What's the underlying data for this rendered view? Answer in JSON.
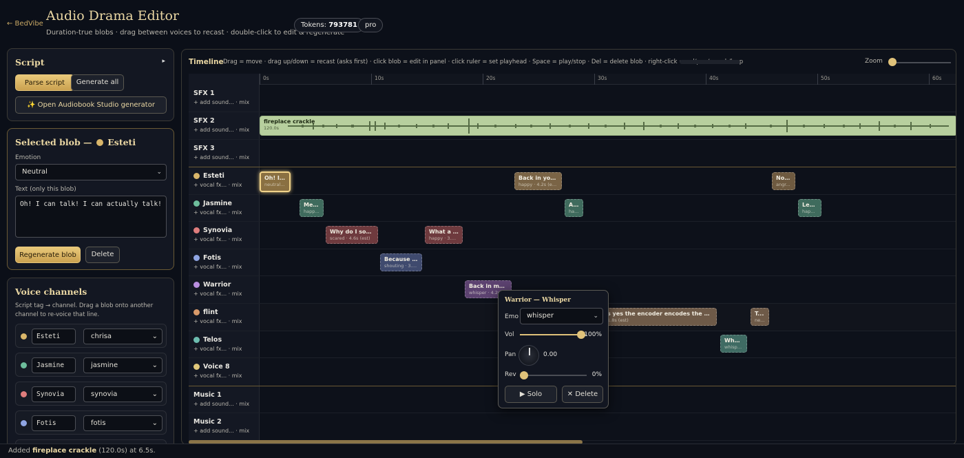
{
  "header": {
    "back_link": "← BedVibe",
    "title": "Audio Drama Editor",
    "subtitle": "Duration-true blobs · drag between voices to recast · double-click to edit & regenerate",
    "tokens_label": "Tokens:",
    "tokens_value": "793781",
    "plan": "pro"
  },
  "script_panel": {
    "title": "Script",
    "toggle": "▸",
    "parse_btn": "Parse script",
    "generate_btn": "Generate all",
    "audiobook_btn": "✨ Open Audiobook Studio generator"
  },
  "selected_panel": {
    "title": "Selected blob —",
    "voice": "Esteti",
    "emotion_label": "Emotion",
    "emotion_value": "Neutral",
    "text_label": "Text (only this blob)",
    "text_value": "Oh! I can talk! I can actually talk!",
    "regen_btn": "Regenerate blob",
    "delete_btn": "Delete"
  },
  "voice_panel": {
    "title": "Voice channels",
    "desc": "Script tag → channel. Drag a blob onto another channel to re-voice that line.",
    "rows": [
      {
        "name": "Esteti",
        "voice": "chrisa",
        "color": "#d9b66a"
      },
      {
        "name": "Jasmine",
        "voice": "jasmine",
        "color": "#6dbd9c"
      },
      {
        "name": "Synovia",
        "voice": "synovia",
        "color": "#df7d7d"
      },
      {
        "name": "Fotis",
        "voice": "fotis",
        "color": "#8fa5e3"
      }
    ]
  },
  "timeline": {
    "title": "Timeline",
    "help": "Drag = move · drag up/down = recast (asks first) · click blob = edit in panel · click ruler = set playhead · Space = play/stop · Del = delete blob · right-click = vol/pan/reverb/loop",
    "zoom_label": "Zoom",
    "ruler": [
      "0s",
      "10s",
      "20s",
      "30s",
      "40s",
      "50s",
      "60s"
    ],
    "tracks": [
      {
        "name": "SFX 1",
        "sub": "+ add sound... · mix"
      },
      {
        "name": "SFX 2",
        "sub": "+ add sound... · mix"
      },
      {
        "name": "SFX 3",
        "sub": "+ add sound... · mix"
      },
      {
        "name": "Esteti",
        "sub": "+ vocal fx... · mix",
        "color": "#d9b66a"
      },
      {
        "name": "Jasmine",
        "sub": "+ vocal fx... · mix",
        "color": "#6dbd9c"
      },
      {
        "name": "Synovia",
        "sub": "+ vocal fx... · mix",
        "color": "#df7d7d"
      },
      {
        "name": "Fotis",
        "sub": "+ vocal fx... · mix",
        "color": "#8fa5e3"
      },
      {
        "name": "Warrior",
        "sub": "+ vocal fx... · mix",
        "color": "#b98ee0"
      },
      {
        "name": "flint",
        "sub": "+ vocal fx... · mix",
        "color": "#d99a6a"
      },
      {
        "name": "Telos",
        "sub": "+ vocal fx... · mix",
        "color": "#6dbdb0"
      },
      {
        "name": "Voice 8",
        "sub": "+ vocal fx... · mix",
        "color": "#e0c77a"
      },
      {
        "name": "Music 1",
        "sub": "+ add sound... · mix"
      },
      {
        "name": "Music 2",
        "sub": "+ add sound... · mix"
      }
    ],
    "blobs": [
      {
        "track": 1,
        "text": "fireplace crackle",
        "meta": "120.0s"
      },
      {
        "track": 3,
        "text": "Oh! I c...",
        "meta": "neutral ·..."
      },
      {
        "track": 3,
        "text": "Back in your ...",
        "meta": "happy · 4.2s (est)"
      },
      {
        "track": 3,
        "text": "No ...",
        "meta": "angr..."
      },
      {
        "track": 4,
        "text": "Me ...",
        "meta": "happ..."
      },
      {
        "track": 4,
        "text": "A...",
        "meta": "ha..."
      },
      {
        "track": 4,
        "text": "Let'...",
        "meta": "happ..."
      },
      {
        "track": 5,
        "text": "Why do I soun...",
        "meta": "scared · 4.6s (est)"
      },
      {
        "track": 5,
        "text": "What a lo...",
        "meta": "happy · 3.4s..."
      },
      {
        "track": 6,
        "text": "Because yo...",
        "meta": "shouting · 3.8..."
      },
      {
        "track": 7,
        "text": "Back in my d...",
        "meta": "whisper · 4.2s..."
      },
      {
        "track": 8,
        "text": "s yes the encoder encodes the audio to...",
        "meta": "1.8s (est)"
      },
      {
        "track": 8,
        "text": "T...",
        "meta": "ne..."
      },
      {
        "track": 9,
        "text": "What ...",
        "meta": "whisper..."
      }
    ]
  },
  "popup": {
    "title": "Warrior — Whisper",
    "emo_label": "Emo",
    "emo_value": "whisper",
    "vol_label": "Vol",
    "vol_value": "100%",
    "vol_level": 0.98,
    "pan_label": "Pan",
    "pan_value": "0.00",
    "rev_label": "Rev",
    "rev_value": "0%",
    "rev_level": 0.0,
    "solo_btn": "▶ Solo",
    "delete_btn": "✕ Delete"
  },
  "status": {
    "prefix": "Added",
    "item": "fireplace crackle",
    "suffix": "(120.0s) at 6.5s."
  },
  "colors": {
    "accent": "#e0c27a",
    "background": "#0b0f18"
  }
}
